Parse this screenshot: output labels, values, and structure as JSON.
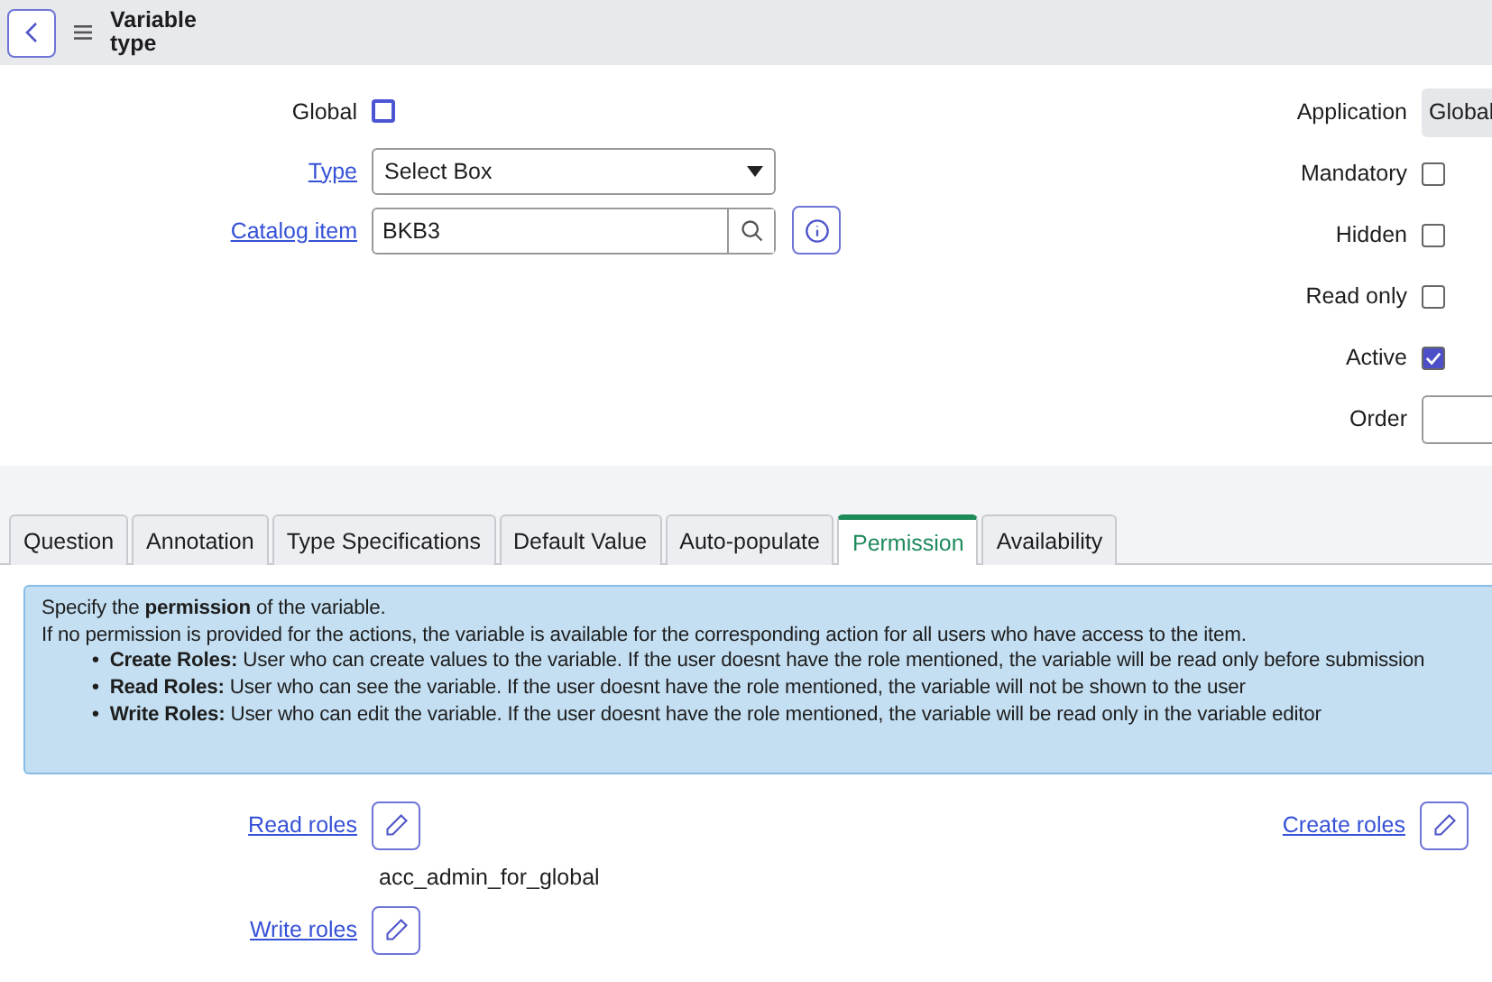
{
  "header": {
    "title": "Variable type"
  },
  "left_fields": [
    {
      "kind": "checkbox",
      "label": "Global",
      "checked": false,
      "link": false
    },
    {
      "kind": "select",
      "label": "Type",
      "value": "Select Box",
      "link": true
    },
    {
      "kind": "reference",
      "label": "Catalog item",
      "value": "BKB3",
      "link": true
    }
  ],
  "right_fields": [
    {
      "kind": "readonly",
      "label": "Application",
      "value": "Global"
    },
    {
      "kind": "checkbox",
      "label": "Mandatory",
      "checked": false
    },
    {
      "kind": "checkbox",
      "label": "Hidden",
      "checked": false
    },
    {
      "kind": "checkbox",
      "label": "Read only",
      "checked": false
    },
    {
      "kind": "checkbox",
      "label": "Active",
      "checked": true
    },
    {
      "kind": "input",
      "label": "Order"
    }
  ],
  "tabs": [
    {
      "label": "Question",
      "selected": false
    },
    {
      "label": "Annotation",
      "selected": false
    },
    {
      "label": "Type Specifications",
      "selected": false
    },
    {
      "label": "Default Value",
      "selected": false
    },
    {
      "label": "Auto-populate",
      "selected": false
    },
    {
      "label": "Permission",
      "selected": true
    },
    {
      "label": "Availability",
      "selected": false
    }
  ],
  "info": {
    "intro": "Specify the **permission** of the variable.",
    "note": "If no permission is provided for the actions, the variable is available for the corresponding action for all users who have access to the item.",
    "marker": "•",
    "bullets": [
      "**Create Roles:** User who can create values to the variable. If the user doesnt have the role mentioned, the variable will be read only before submission",
      "**Read Roles:** User who can see the variable. If the user doesnt have the role mentioned, the variable will not be shown to the user",
      "**Write Roles:** User who can edit the variable. If the user doesnt have the role mentioned, the variable will be read only in the variable editor"
    ]
  },
  "roles_left": [
    {
      "label": "Read roles",
      "values": [
        "acc_admin_for_global"
      ]
    },
    {
      "label": "Write roles"
    }
  ],
  "roles_right": [
    {
      "label": "Create roles"
    }
  ]
}
